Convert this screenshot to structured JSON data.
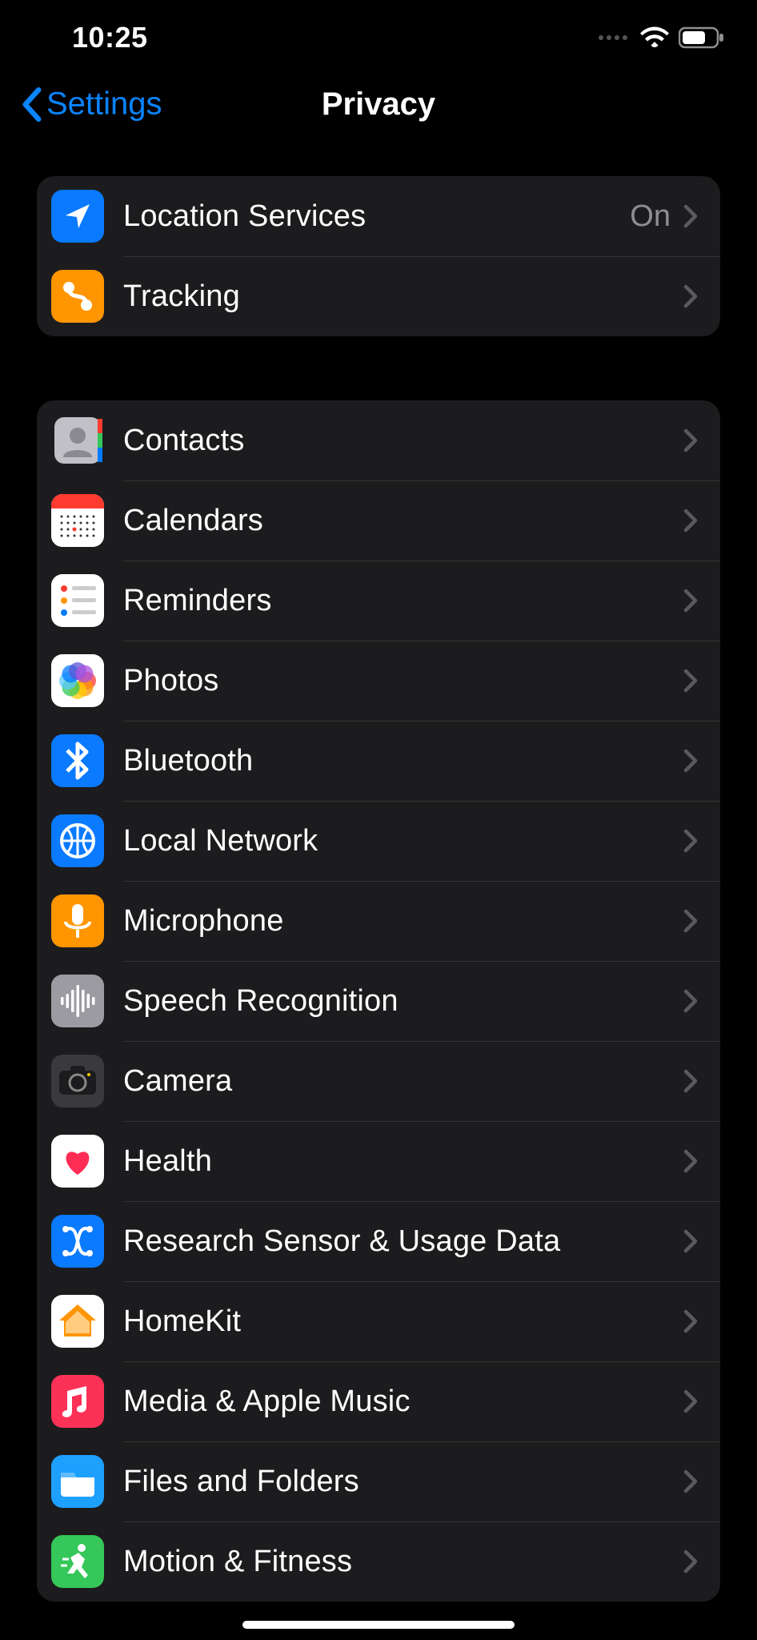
{
  "status": {
    "time": "10:25"
  },
  "nav": {
    "back_label": "Settings",
    "title": "Privacy"
  },
  "group1": [
    {
      "id": "location-services",
      "label": "Location Services",
      "value": "On",
      "icon": "location",
      "bg": "#0a7aff"
    },
    {
      "id": "tracking",
      "label": "Tracking",
      "value": "",
      "icon": "tracking",
      "bg": "#ff9500"
    }
  ],
  "group2": [
    {
      "id": "contacts",
      "label": "Contacts",
      "icon": "contacts",
      "bg": "#b5b5bb"
    },
    {
      "id": "calendars",
      "label": "Calendars",
      "icon": "calendar",
      "bg": "#ffffff"
    },
    {
      "id": "reminders",
      "label": "Reminders",
      "icon": "reminders",
      "bg": "#ffffff"
    },
    {
      "id": "photos",
      "label": "Photos",
      "icon": "photos",
      "bg": "#ffffff"
    },
    {
      "id": "bluetooth",
      "label": "Bluetooth",
      "icon": "bluetooth",
      "bg": "#0a7aff"
    },
    {
      "id": "local-network",
      "label": "Local Network",
      "icon": "network",
      "bg": "#0a7aff"
    },
    {
      "id": "microphone",
      "label": "Microphone",
      "icon": "microphone",
      "bg": "#ff9500"
    },
    {
      "id": "speech-recognition",
      "label": "Speech Recognition",
      "icon": "speech",
      "bg": "#9b9ba1"
    },
    {
      "id": "camera",
      "label": "Camera",
      "icon": "camera",
      "bg": "#9b9ba1"
    },
    {
      "id": "health",
      "label": "Health",
      "icon": "health",
      "bg": "#ffffff"
    },
    {
      "id": "research",
      "label": "Research Sensor & Usage Data",
      "icon": "research",
      "bg": "#0a7aff"
    },
    {
      "id": "homekit",
      "label": "HomeKit",
      "icon": "homekit",
      "bg": "#ffffff"
    },
    {
      "id": "media",
      "label": "Media & Apple Music",
      "icon": "music",
      "bg": "#fc3158"
    },
    {
      "id": "files",
      "label": "Files and Folders",
      "icon": "files",
      "bg": "#0a7aff"
    },
    {
      "id": "motion",
      "label": "Motion & Fitness",
      "icon": "motion",
      "bg": "#35c759"
    }
  ]
}
